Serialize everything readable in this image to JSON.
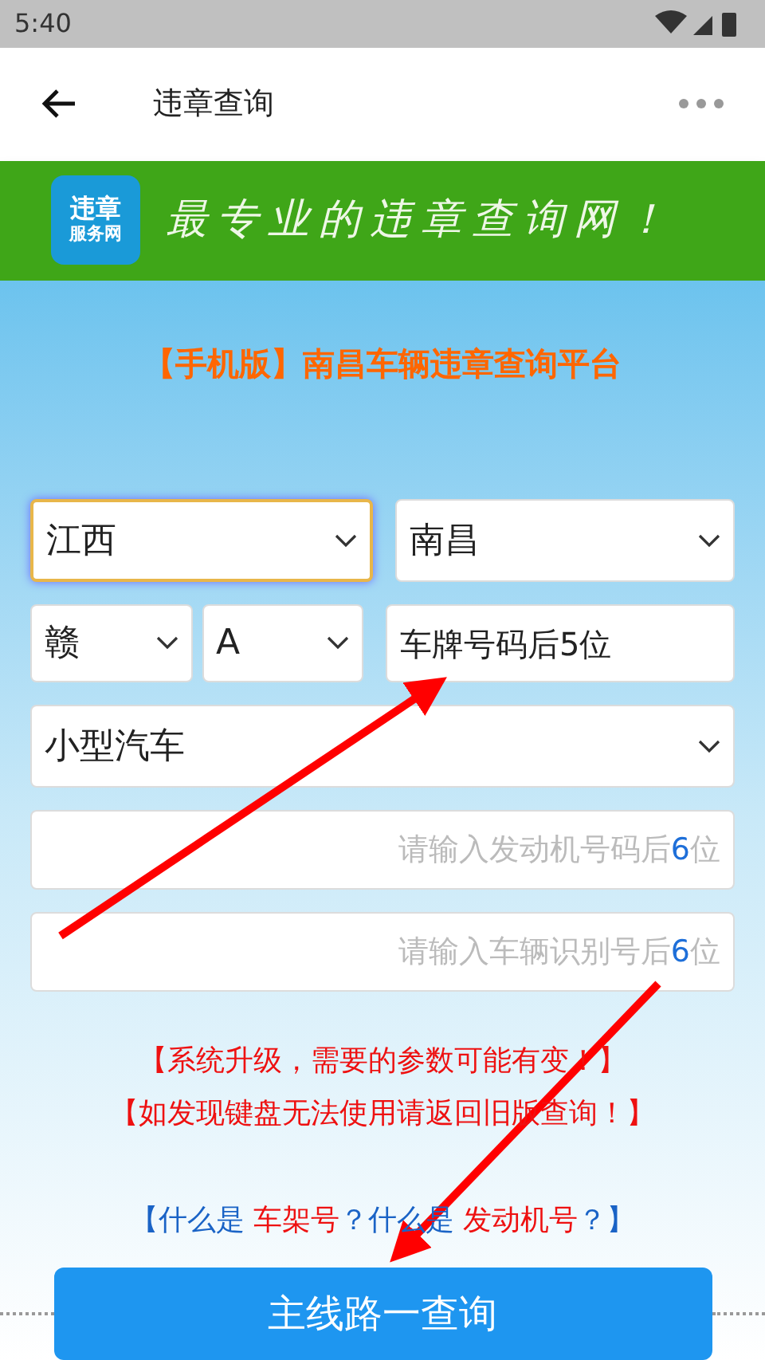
{
  "status_bar": {
    "time": "5:40"
  },
  "app_bar": {
    "title": "违章查询"
  },
  "banner": {
    "logo_top": "违章",
    "logo_bottom": "服务网",
    "slogan": "最专业的违章查询网！"
  },
  "page_title": "【手机版】南昌车辆违章查询平台",
  "form": {
    "rows": [
      {
        "kind": "selects",
        "fields": [
          {
            "value": "江西",
            "focused": true
          },
          {
            "value": "南昌",
            "focused": false
          }
        ]
      },
      {
        "kind": "plate",
        "fields": [
          {
            "value": "赣",
            "focused": false
          },
          {
            "value": "A",
            "focused": false
          }
        ],
        "input": {
          "placeholder": "车牌号码后5位"
        }
      },
      {
        "kind": "selects",
        "fields": [
          {
            "value": "小型汽车",
            "focused": false
          }
        ]
      },
      {
        "kind": "input",
        "placeholder": {
          "prefix": "请输入发动机号码后",
          "digit": "6",
          "suffix": "位"
        }
      },
      {
        "kind": "input",
        "placeholder": {
          "prefix": "请输入车辆识别号后",
          "digit": "6",
          "suffix": "位"
        }
      }
    ]
  },
  "notices": [
    "【系统升级，需要的参数可能有变！】",
    "【如发现键盘无法使用请返回旧版查询！】"
  ],
  "help": [
    {
      "text": "【什么是 ",
      "kind": "plain"
    },
    {
      "text": "车架号",
      "kind": "link"
    },
    {
      "text": "？什么是 ",
      "kind": "plain"
    },
    {
      "text": "发动机号",
      "kind": "link"
    },
    {
      "text": "？】",
      "kind": "plain"
    }
  ],
  "submit": "主线路一查询"
}
